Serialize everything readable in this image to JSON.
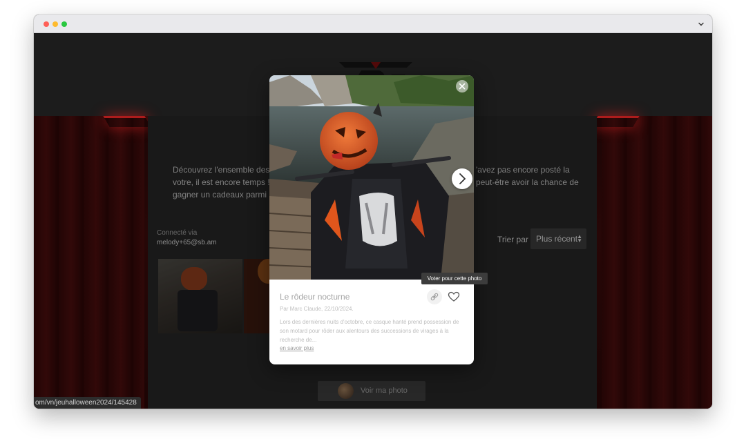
{
  "intro": {
    "left_lines": [
      "Découvrez l'ensemble des t",
      "votre, il est encore temps !",
      "gagner un cadeaux parmi no"
    ],
    "right_lines": [
      "'avez pas encore posté la",
      "peut-être avoir la chance de"
    ]
  },
  "account": {
    "label": "Connecté via",
    "email": "melody+65@sb.am"
  },
  "sort": {
    "label": "Trier par",
    "selected": "Plus récent"
  },
  "my_photo": {
    "label": "Voir ma photo"
  },
  "modal": {
    "title": "Le rôdeur nocturne",
    "byline": "Par Marc Claude, 22/10/2024.",
    "description": "Lors des dernières nuits d'octobre, ce casque hanté prend possession de son motard pour rôder aux alentours des successions de virages à la recherche de...",
    "read_more": "en savoir plus",
    "tooltip": "Voter pour cette photo"
  },
  "status_url": "om/vn/jeuhalloween2024/145428",
  "icons": {
    "close": "close-icon",
    "next": "chevron-right-icon",
    "link": "link-icon",
    "vote": "heart-icon",
    "window_menu": "chevron-down-icon"
  },
  "colors": {
    "neon_accent": "#ff2a2a",
    "modal_bg": "#ffffff",
    "tooltip_bg": "#3c3c3c"
  }
}
